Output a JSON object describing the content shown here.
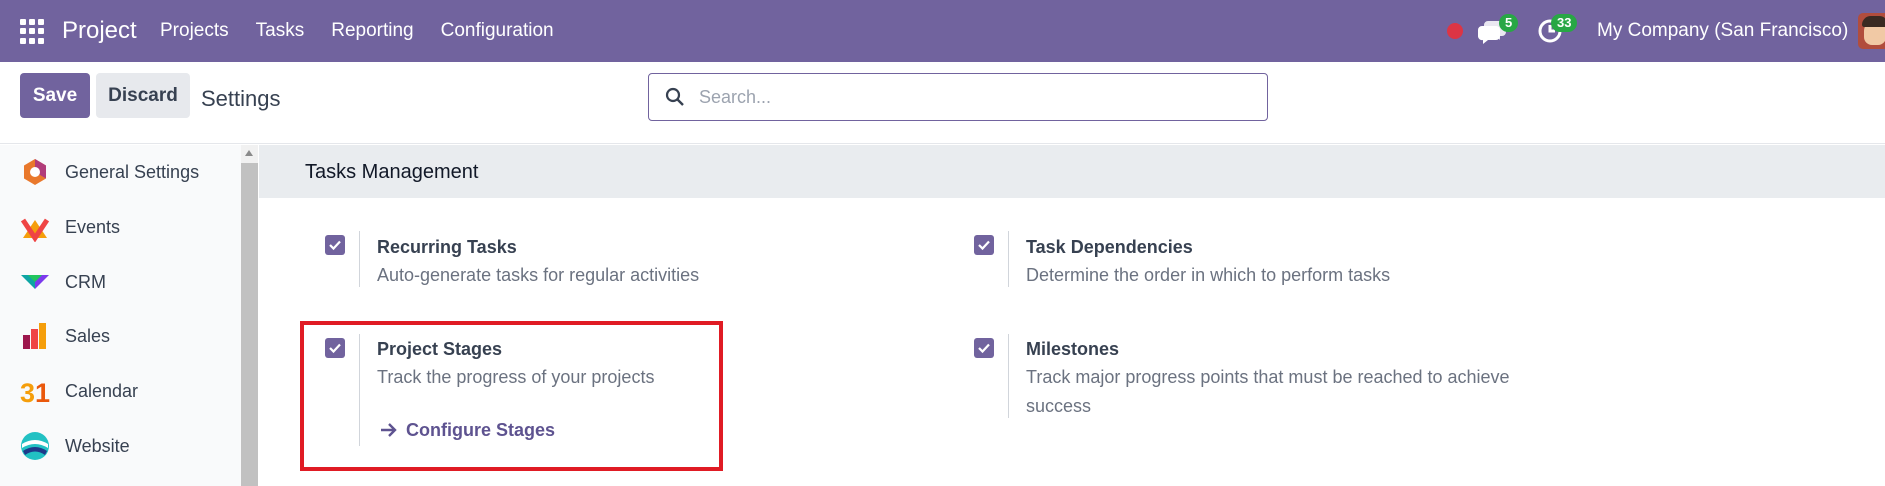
{
  "navbar": {
    "brand": "Project",
    "menu": [
      "Projects",
      "Tasks",
      "Reporting",
      "Configuration"
    ],
    "chat_count": "5",
    "activity_count": "33",
    "company": "My Company (San Francisco)"
  },
  "control": {
    "save_label": "Save",
    "discard_label": "Discard",
    "breadcrumb": "Settings",
    "search_placeholder": "Search..."
  },
  "sidebar": {
    "items": [
      {
        "label": "General Settings",
        "icon": "general-settings-icon"
      },
      {
        "label": "Events",
        "icon": "events-icon"
      },
      {
        "label": "CRM",
        "icon": "crm-icon"
      },
      {
        "label": "Sales",
        "icon": "sales-icon"
      },
      {
        "label": "Calendar",
        "icon": "calendar-icon"
      },
      {
        "label": "Website",
        "icon": "website-icon"
      }
    ]
  },
  "section": {
    "title": "Tasks Management",
    "settings": [
      {
        "title": "Recurring Tasks",
        "desc": "Auto-generate tasks for regular activities",
        "checked": true
      },
      {
        "title": "Task Dependencies",
        "desc": "Determine the order in which to perform tasks",
        "checked": true
      },
      {
        "title": "Project Stages",
        "desc": "Track the progress of your projects",
        "checked": true,
        "action": "Configure Stages"
      },
      {
        "title": "Milestones",
        "desc": "Track major progress points that must be reached to achieve success",
        "checked": true
      }
    ]
  },
  "colors": {
    "brand": "#71639e",
    "highlight": "#e01b24",
    "badge": "#28a745"
  }
}
